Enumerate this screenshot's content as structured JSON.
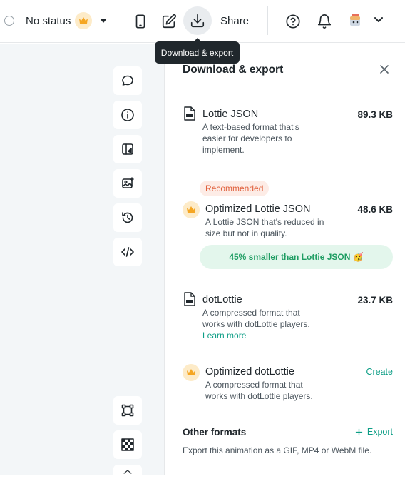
{
  "toolbar": {
    "status_label": "No status",
    "share_label": "Share",
    "tooltip": "Download & export",
    "icons": [
      "status-radio-icon",
      "crown-icon",
      "chevron-down-icon",
      "mobile-icon",
      "edit-icon",
      "download-icon",
      "help-icon",
      "bell-icon",
      "avatar",
      "chevron-down-icon"
    ]
  },
  "sidebar": {
    "tools": [
      "comment-icon",
      "info-icon",
      "layers-icon",
      "image-icon",
      "history-icon",
      "code-icon",
      "bounding-box-icon",
      "transparency-grid-icon"
    ]
  },
  "panel": {
    "title": "Download & export",
    "options": [
      {
        "name": "Lottie JSON",
        "size": "89.3 KB",
        "description": "A text-based format that's easier for developers to implement."
      },
      {
        "badge": "Recommended",
        "name": "Optimized Lottie JSON",
        "size": "48.6 KB",
        "description": "A Lottie JSON that's reduced in size but not in quality.",
        "savings": "45% smaller than Lottie JSON 🥳"
      },
      {
        "name": "dotLottie",
        "size": "23.7 KB",
        "description": "A compressed format that works with dotLottie players.",
        "link": "Learn more"
      },
      {
        "name": "Optimized dotLottie",
        "action": "Create",
        "description": "A compressed format that works with dotLottie players."
      }
    ],
    "other": {
      "title": "Other formats",
      "action": "Export",
      "description": "Export this animation as a GIF, MP4 or WebM file."
    }
  },
  "colors": {
    "accent": "#0d9e86",
    "recommended_text": "#e0603c",
    "savings_bg": "#e3f6ec",
    "crown_bg": "#fdebc8",
    "crown": "#f5a623"
  }
}
